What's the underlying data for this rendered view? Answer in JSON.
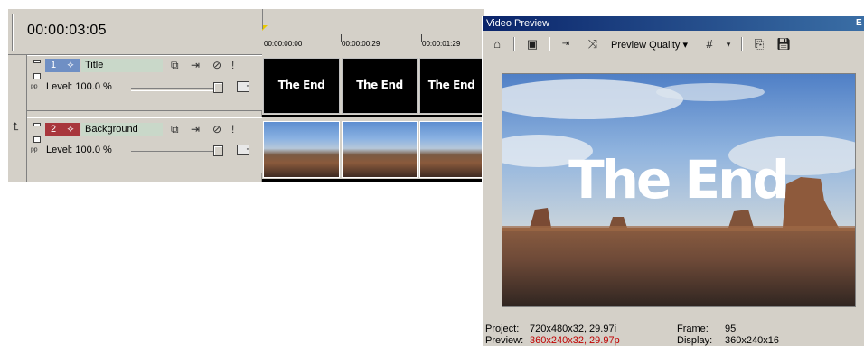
{
  "header": {
    "timecode": "00:00:03:05"
  },
  "tracks": [
    {
      "number": "1",
      "name": "Title",
      "level_label": "Level: 100.0 %",
      "color": "#6f8fc4",
      "name_bg": "#c9d8c9"
    },
    {
      "number": "2",
      "name": "Background",
      "level_label": "Level: 100.0 %",
      "color": "#a8363c",
      "name_bg": "#c9d8c9"
    }
  ],
  "ruler": {
    "labels": [
      "00:00:00:00",
      "00:00:00:29",
      "00:00:01:29"
    ]
  },
  "clips": {
    "title_text": "The End"
  },
  "preview": {
    "window_title": "Video Preview",
    "quality_label": "Preview Quality",
    "overlay_text": "The End",
    "project_label": "Project:",
    "project_value": "720x480x32, 29.97i",
    "preview_label": "Preview:",
    "preview_value": "360x240x32, 29.97p",
    "preview_value_color": "#c00000",
    "frame_label": "Frame:",
    "frame_value": "95",
    "display_label": "Display:",
    "display_value": "360x240x16"
  }
}
